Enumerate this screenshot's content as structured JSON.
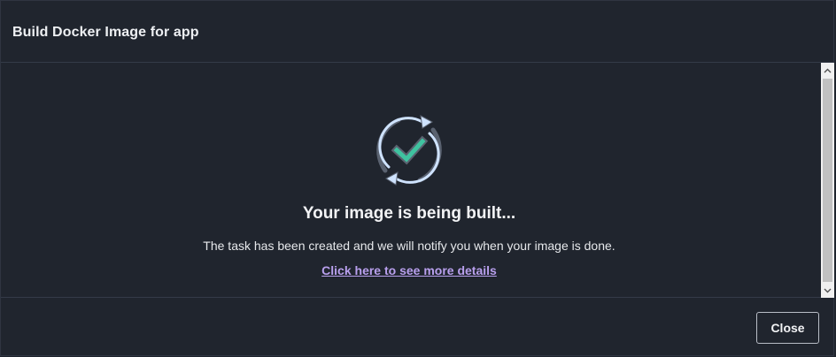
{
  "dialog": {
    "title": "Build Docker Image for app"
  },
  "status": {
    "icon": "sync-check-icon",
    "heading": "Your image is being built...",
    "message": "The task has been created and we will notify you when your image is done.",
    "details_link": "Click here to see more details"
  },
  "footer": {
    "close_label": "Close"
  },
  "colors": {
    "background": "#20252e",
    "divider": "#343b48",
    "link": "#b9a0ee",
    "check": "#3fc3a0",
    "ring": "#5a6270",
    "arrow": "#cfe3ff"
  }
}
